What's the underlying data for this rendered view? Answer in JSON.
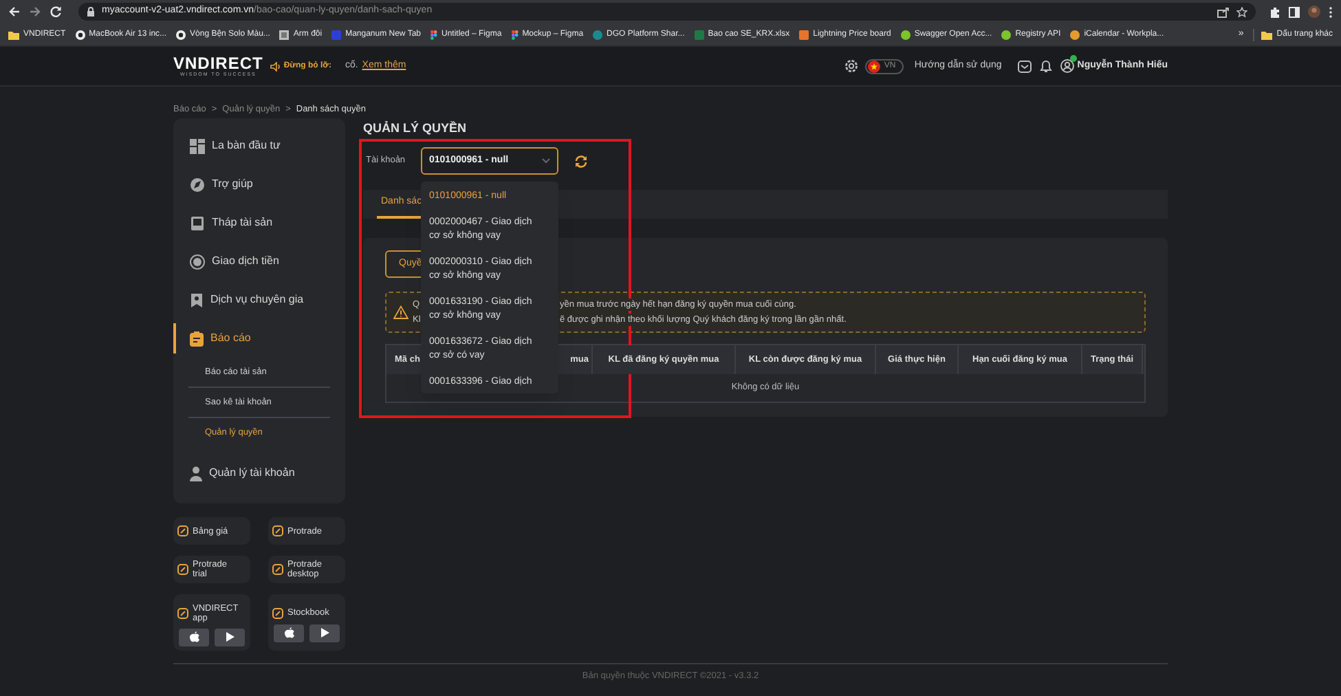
{
  "browser": {
    "url_host": "myaccount-v2-uat2.vndirect.com.vn",
    "url_path": "/bao-cao/quan-ly-quyen/danh-sach-quyen",
    "bookmarks": [
      {
        "label": "VNDIRECT",
        "kind": "folder"
      },
      {
        "label": "MacBook Air 13 inc...",
        "kind": "ring"
      },
      {
        "label": "Vòng Bện Solo Màu...",
        "kind": "ring"
      },
      {
        "label": "Arm đôi",
        "kind": "image"
      },
      {
        "label": "Manganum New Tab",
        "kind": "tile",
        "color": "#2b3fd6"
      },
      {
        "label": "Untitled – Figma",
        "kind": "figma"
      },
      {
        "label": "Mockup – Figma",
        "kind": "figma"
      },
      {
        "label": "DGO Platform Shar...",
        "kind": "badge",
        "color": "#1b8a8f"
      },
      {
        "label": "Bao cao SE_KRX.xlsx",
        "kind": "tile",
        "color": "#1d7a45"
      },
      {
        "label": "Lightning Price board",
        "kind": "tile",
        "color": "#e8742a"
      },
      {
        "label": "Swagger Open Acc...",
        "kind": "badge",
        "color": "#7dc42a"
      },
      {
        "label": "Registry API",
        "kind": "badge",
        "color": "#7dc42a"
      },
      {
        "label": "iCalendar - Workpla...",
        "kind": "badge",
        "color": "#e89a2a"
      }
    ],
    "more": "»",
    "other_bookmarks": "Dấu trang khác"
  },
  "header": {
    "logo": "VNDIRECT",
    "tagline": "WISDOM TO SUCCESS",
    "ticker_label": "Đừng bỏ lỡ:",
    "ticker_text": "cố.",
    "ticker_link": "Xem thêm",
    "language": "VN",
    "guide": "Hướng dẫn sử dụng",
    "user_name": "Nguyễn Thành Hiếu",
    "user_online": true
  },
  "breadcrumb": [
    {
      "label": "Báo cáo",
      "current": false
    },
    {
      "separator": ">",
      "label": "Quản lý quyền",
      "current": false
    },
    {
      "separator": ">",
      "label": "Danh sách quyền",
      "current": true
    }
  ],
  "sidebar": {
    "menu": [
      {
        "label": "La bàn đầu tư",
        "kind": "grid",
        "selected": false
      },
      {
        "label": "Trợ giúp",
        "kind": "chat",
        "selected": false
      },
      {
        "label": "Tháp tài sản",
        "kind": "book",
        "selected": false
      },
      {
        "label": "Giao dịch tiền",
        "kind": "coin",
        "selected": false
      },
      {
        "label": "Dịch vụ chuyên gia",
        "kind": "badge",
        "selected": false
      },
      {
        "label": "Báo cáo",
        "kind": "clipboard",
        "selected": true,
        "children": [
          {
            "label": "Báo cáo tài sản",
            "selected": false
          },
          {
            "label": "Sao kê tài khoản",
            "selected": false
          },
          {
            "label": "Quản lý quyền",
            "selected": true
          }
        ]
      },
      {
        "label": "Quản lý tài khoản",
        "kind": "person",
        "selected": false
      }
    ],
    "apps": [
      {
        "label": "Bảng giá",
        "kind": "link"
      },
      {
        "label": "Protrade",
        "kind": "link"
      },
      {
        "label": "Protrade trial",
        "kind": "link"
      },
      {
        "label": "Protrade desktop",
        "kind": "link"
      },
      {
        "label": "VNDIRECT app",
        "kind": "store"
      },
      {
        "label": "Stockbook",
        "kind": "store"
      }
    ]
  },
  "page": {
    "title": "QUẢN LÝ QUYỀN",
    "account_label": "Tài khoản",
    "account_value": "0101000961 - null",
    "tabs": [
      {
        "label": "Danh sác",
        "selected": true
      }
    ],
    "filter_button": "Quyề",
    "warning": [
      {
        "start": "Q",
        "rest": "yền mua trước ngày hết hạn đăng ký quyền mua cuối cùng."
      },
      {
        "start": "Kl",
        "rest": "ẽ được ghi nhận theo khối lượng Quý khách đăng ký trong lần gần nhất."
      }
    ],
    "table": {
      "columns": [
        "Mã ch",
        "mua",
        "KL đã đăng ký quyền mua",
        "KL còn được đăng ký mua",
        "Giá thực hiện",
        "Hạn cuối đăng ký mua",
        "Trạng thái"
      ],
      "empty": "Không có dữ liệu"
    },
    "account_dropdown": [
      {
        "label": "0101000961 - null",
        "selected": true
      },
      {
        "label": "0002000467 - Giao dịch cơ sở không vay",
        "selected": false
      },
      {
        "label": "0002000310 - Giao dịch cơ sở không vay",
        "selected": false
      },
      {
        "label": "0001633190 - Giao dịch cơ sở không vay",
        "selected": false
      },
      {
        "label": "0001633672 - Giao dịch cơ sở có vay",
        "selected": false
      },
      {
        "label": "0001633396 - Giao dịch",
        "selected": false
      }
    ]
  },
  "footer": "Bản quyền thuộc VNDIRECT ©2021 - v3.3.2"
}
